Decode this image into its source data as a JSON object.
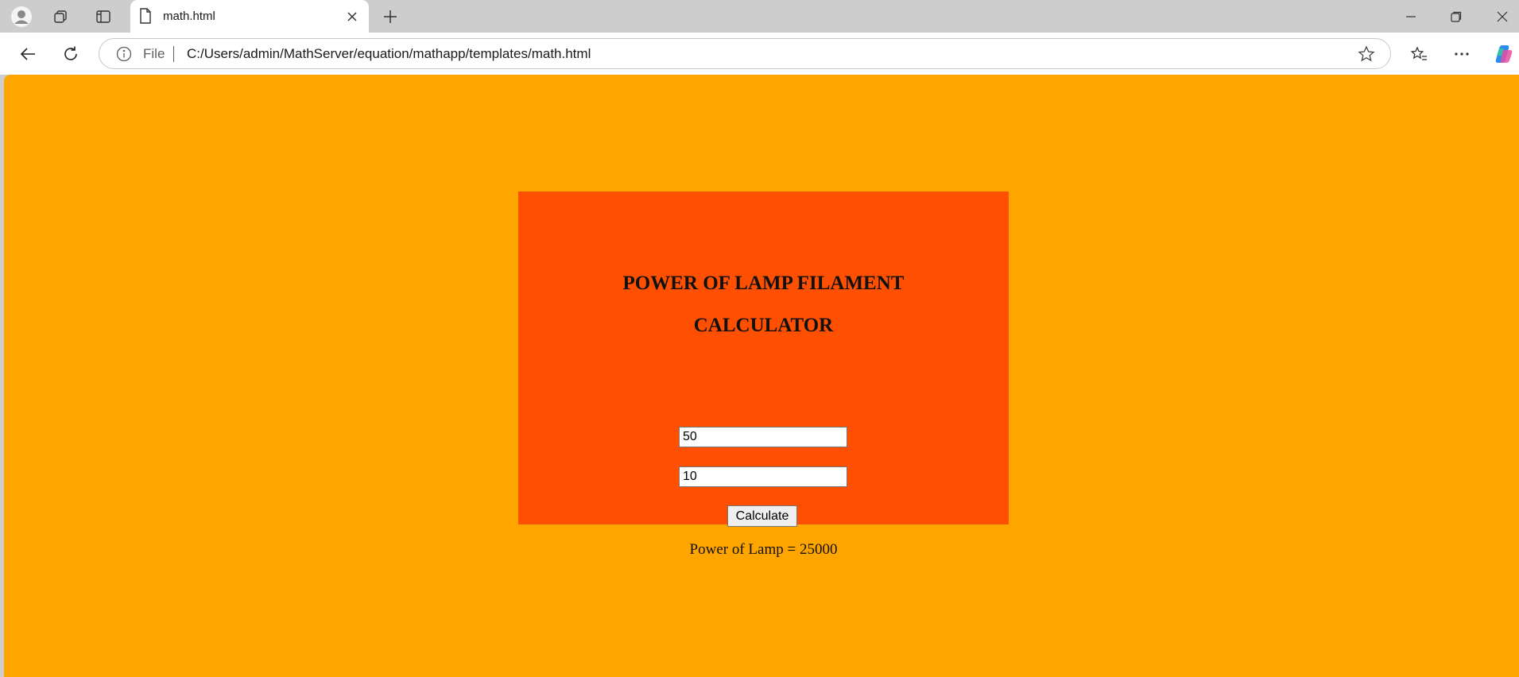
{
  "browser": {
    "tab_title": "math.html",
    "url_scheme": "File",
    "url": "C:/Users/admin/MathServer/equation/mathapp/templates/math.html"
  },
  "page": {
    "heading_line1": "POWER OF LAMP FILAMENT",
    "heading_line2": "CALCULATOR",
    "input1_value": "50",
    "input2_value": "10",
    "calculate_label": "Calculate",
    "result_text": "Power of Lamp = 25000"
  },
  "colors": {
    "page_background": "#ffa500",
    "card_background": "#ff4f00"
  }
}
